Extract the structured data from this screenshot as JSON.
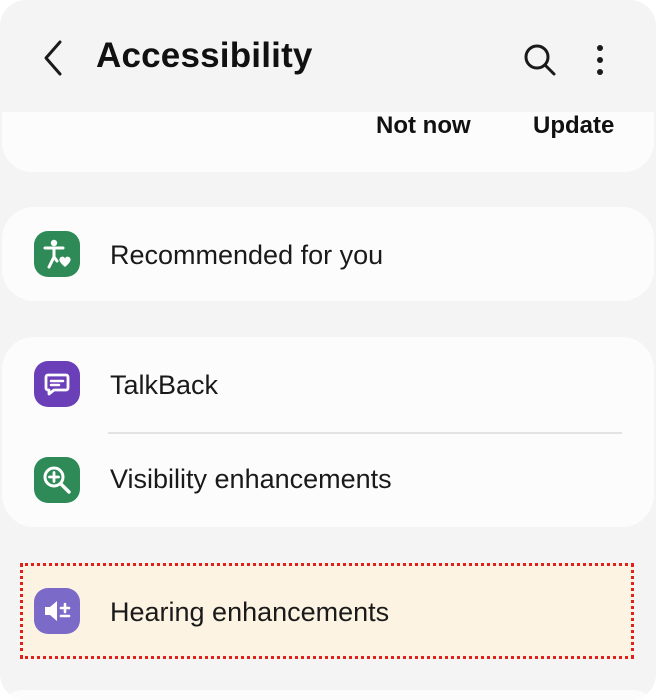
{
  "header": {
    "title": "Accessibility",
    "back_icon": "chevron-left-icon",
    "search_icon": "search-icon",
    "more_icon": "more-vertical-icon"
  },
  "banner": {
    "not_now_label": "Not now",
    "update_label": "Update"
  },
  "recommended": {
    "label": "Recommended for you",
    "icon": "accessibility-heart-icon",
    "icon_color": "#2e8b57"
  },
  "items": [
    {
      "label": "TalkBack",
      "icon": "speech-bubble-icon",
      "icon_color": "#6b3fb8"
    },
    {
      "label": "Visibility enhancements",
      "icon": "magnifier-plus-icon",
      "icon_color": "#2e8b57"
    },
    {
      "label": "Hearing enhancements",
      "icon": "speaker-plus-minus-icon",
      "icon_color": "#7b6ac8"
    }
  ],
  "colors": {
    "background": "#f4f4f4",
    "card": "#fcfcfc",
    "highlight_fill": "#fcf3e2",
    "highlight_border": "#e0201d"
  }
}
